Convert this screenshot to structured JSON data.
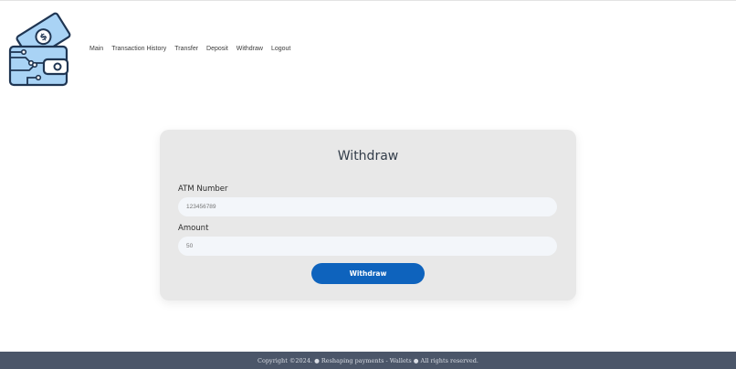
{
  "header": {
    "logo_icon": "wallet-money-icon",
    "nav": [
      {
        "label": "Main"
      },
      {
        "label": "Transaction History"
      },
      {
        "label": "Transfer"
      },
      {
        "label": "Deposit"
      },
      {
        "label": "Withdraw"
      },
      {
        "label": "Logout"
      }
    ]
  },
  "form": {
    "title": "Withdraw",
    "atm_label": "ATM Number",
    "atm_placeholder": "123456789",
    "amount_label": "Amount",
    "amount_placeholder": "50",
    "submit_label": "Withdraw"
  },
  "footer": {
    "text": "Copyright ©2024. ● Reshaping payments - Wallets ● All rights reserved."
  },
  "colors": {
    "primary_button": "#0e63bd",
    "footer_bg": "#4b5669",
    "card_bg": "#e8e8e8",
    "logo_fill": "#a9d3f5",
    "logo_stroke": "#1f3552"
  }
}
